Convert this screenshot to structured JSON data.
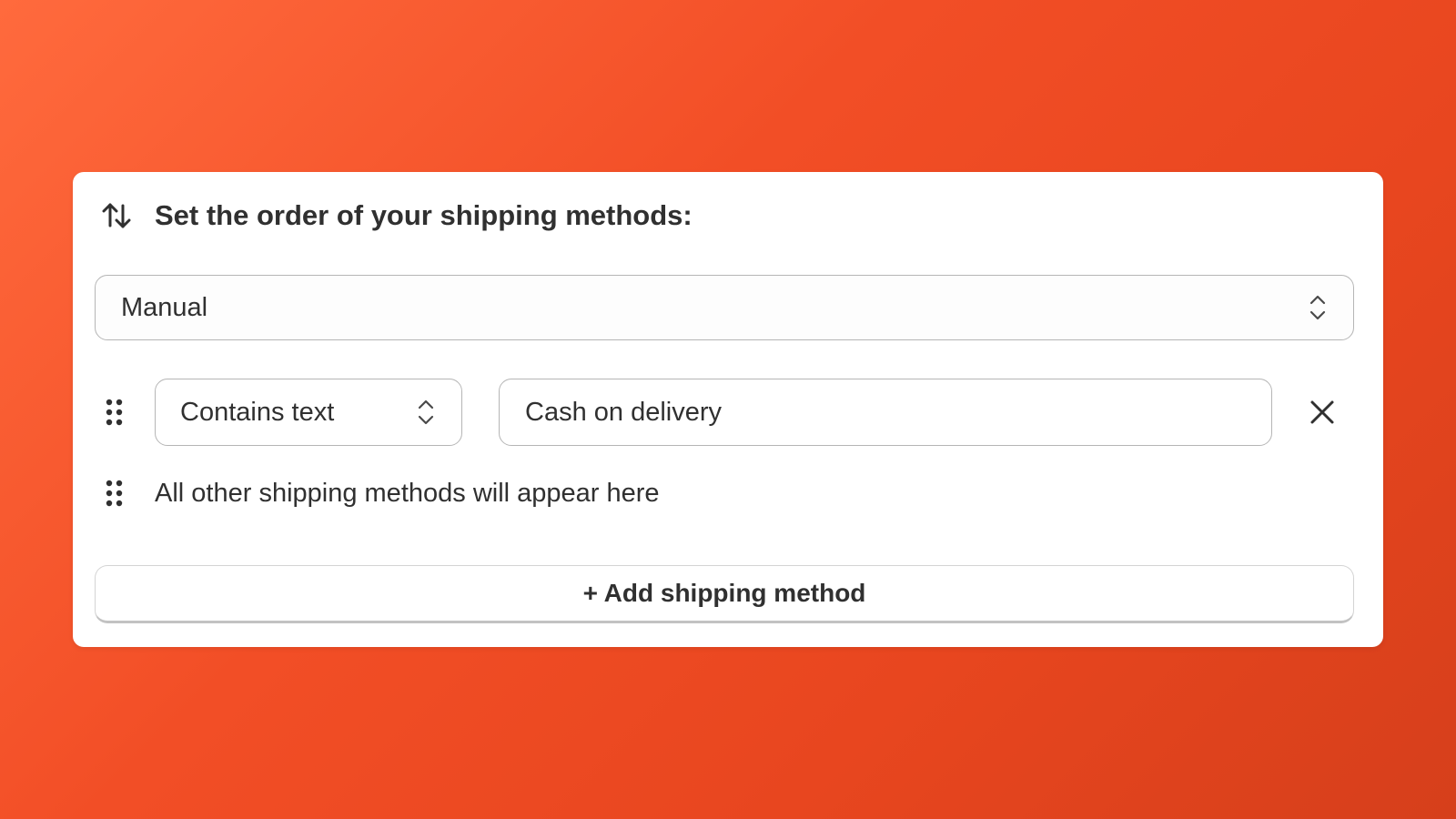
{
  "card": {
    "title": "Set the order of your shipping methods:",
    "title_icon": "sort-arrows-icon"
  },
  "order_select": {
    "value": "Manual",
    "icon": "chevron-up-down-icon"
  },
  "rules": [
    {
      "condition": "Contains text",
      "value": "Cash on delivery",
      "drag_icon": "drag-handle-icon",
      "remove_icon": "close-icon"
    }
  ],
  "other_methods": {
    "label": "All other shipping methods will appear here",
    "drag_icon": "drag-handle-icon"
  },
  "add_button": {
    "label": "+ Add shipping method"
  },
  "colors": {
    "background_start": "#ff6a3d",
    "background_end": "#d63f1b",
    "card": "#ffffff",
    "text": "#303030",
    "border": "#b5b5b5"
  }
}
